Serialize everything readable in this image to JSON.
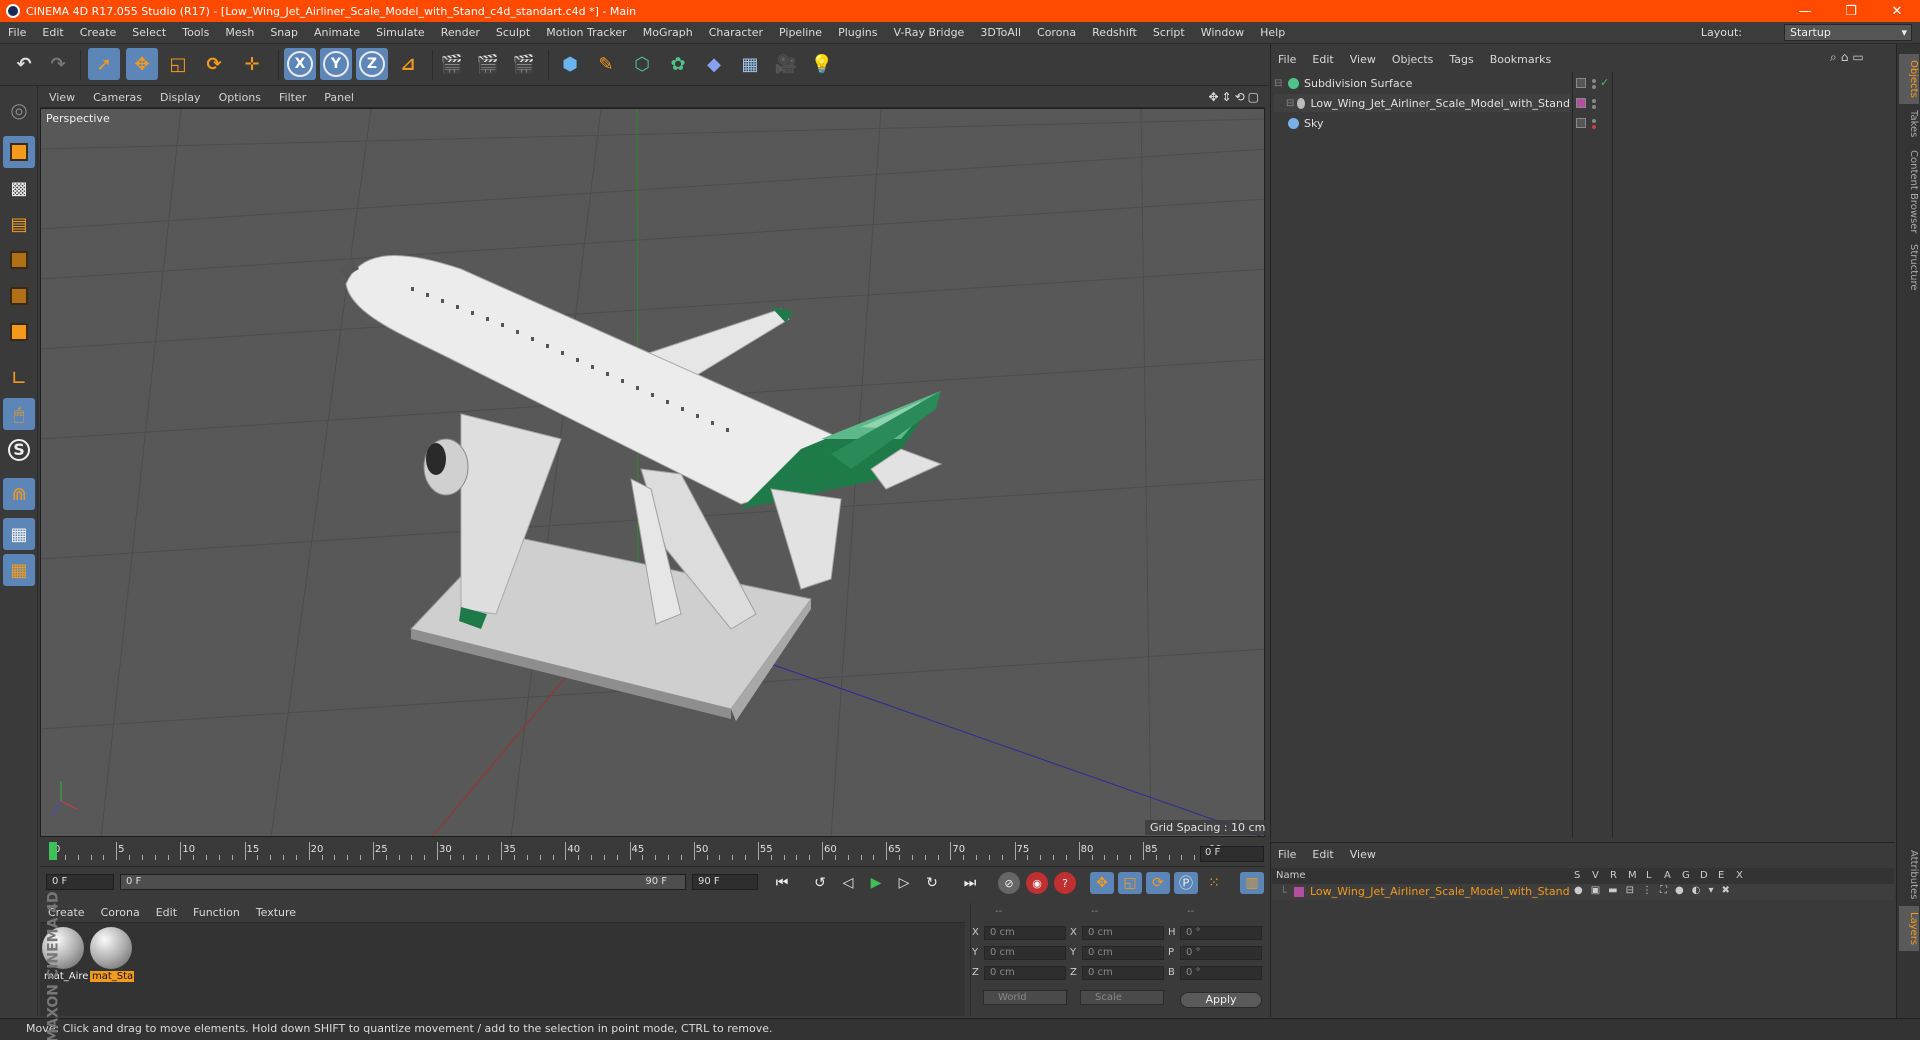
{
  "window": {
    "title": "CINEMA 4D R17.055 Studio (R17) - [Low_Wing_Jet_Airliner_Scale_Model_with_Stand_c4d_standart.c4d *] - Main",
    "minimize": "—",
    "restore": "❐",
    "close": "✕"
  },
  "menu": [
    "File",
    "Edit",
    "Create",
    "Select",
    "Tools",
    "Mesh",
    "Snap",
    "Animate",
    "Simulate",
    "Render",
    "Sculpt",
    "Motion Tracker",
    "MoGraph",
    "Character",
    "Pipeline",
    "Plugins",
    "V-Ray Bridge",
    "3DToAll",
    "Corona",
    "Redshift",
    "Script",
    "Window",
    "Help"
  ],
  "layout": {
    "label": "Layout:",
    "value": "Startup"
  },
  "toolbar": {
    "axis_x": "X",
    "axis_y": "Y",
    "axis_z": "Z"
  },
  "viewport": {
    "menu": [
      "View",
      "Cameras",
      "Display",
      "Options",
      "Filter",
      "Panel"
    ],
    "camera_label": "Perspective",
    "grid_spacing": "Grid Spacing : 10 cm",
    "nav_icons": "✥⇕⟲▢"
  },
  "timeline": {
    "ticks": [
      "0",
      "5",
      "10",
      "15",
      "20",
      "25",
      "30",
      "35",
      "40",
      "45",
      "50",
      "55",
      "60",
      "65",
      "70",
      "75",
      "80",
      "85",
      "90"
    ],
    "end_frame": "0 F"
  },
  "transport": {
    "start": "0 F",
    "range_start": "0 F",
    "range_end": "90 F",
    "end": "90 F"
  },
  "materials": {
    "menu": [
      "Create",
      "Corona",
      "Edit",
      "Function",
      "Texture"
    ],
    "items": [
      {
        "label": "mat_Aire",
        "selected": false
      },
      {
        "label": "mat_Sta",
        "selected": true
      }
    ]
  },
  "coordinates": {
    "col_headers": [
      "--",
      "--",
      "--"
    ],
    "rows": [
      {
        "a": "X",
        "av": "0 cm",
        "b": "X",
        "bv": "0 cm",
        "c": "H",
        "cv": "0 °"
      },
      {
        "a": "Y",
        "av": "0 cm",
        "b": "Y",
        "bv": "0 cm",
        "c": "P",
        "cv": "0 °"
      },
      {
        "a": "Z",
        "av": "0 cm",
        "b": "Z",
        "bv": "0 cm",
        "c": "B",
        "cv": "0 °"
      }
    ],
    "space": "World",
    "mode": "Scale",
    "apply": "Apply"
  },
  "status": "Move: Click and drag to move elements. Hold down SHIFT to quantize movement / add to the selection in point mode, CTRL to remove.",
  "brand": "MAXON CINEMA 4D",
  "objects": {
    "menu": [
      "File",
      "Edit",
      "View",
      "Objects",
      "Tags",
      "Bookmarks"
    ],
    "items": [
      {
        "name": "Subdivision Surface",
        "icon_color": "#4ec48a",
        "indent": 0
      },
      {
        "name": "Low_Wing_Jet_Airliner_Scale_Model_with_Stand",
        "icon_color": "#bbbbbb",
        "indent": 1
      },
      {
        "name": "Sky",
        "icon_color": "#7ab0e8",
        "indent": 0
      }
    ]
  },
  "side_tabs": [
    "Objects",
    "Takes",
    "Content Browser",
    "Structure"
  ],
  "side_tabs_bottom": [
    "Attributes",
    "Layers"
  ],
  "layers": {
    "menu": [
      "File",
      "Edit",
      "View"
    ],
    "columns": [
      "Name",
      "S",
      "V",
      "R",
      "M",
      "L",
      "A",
      "G",
      "D",
      "E",
      "X"
    ],
    "rows": [
      {
        "name": "Low_Wing_Jet_Airliner_Scale_Model_with_Stand",
        "color": "#b44fa0"
      }
    ]
  },
  "colors": {
    "accent": "#ff4a00",
    "selection": "#5c86b8",
    "highlight": "#f39a1c",
    "livery_green": "#1f7a4a"
  }
}
